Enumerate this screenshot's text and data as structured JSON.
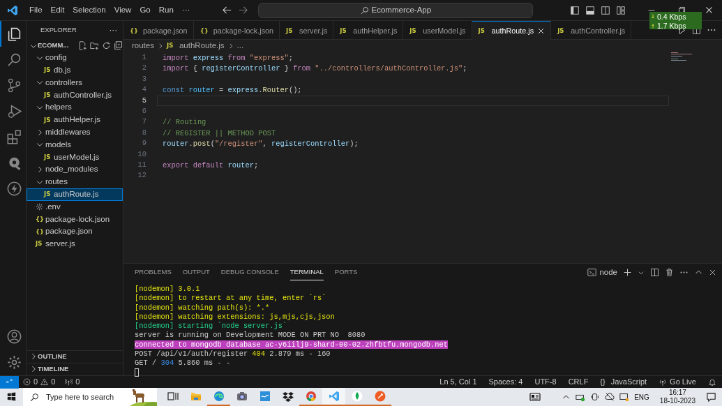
{
  "title_bar": {
    "menu": [
      "File",
      "Edit",
      "Selection",
      "View",
      "Go",
      "Run",
      "···"
    ],
    "search": "Ecommerce-App"
  },
  "network_widget": {
    "download": "0.4 Kbps",
    "upload": "1.7 Kbps"
  },
  "activity_bar": [
    {
      "kind": "explorer",
      "selected": true
    },
    {
      "kind": "search",
      "selected": false
    },
    {
      "kind": "source-control",
      "selected": false
    },
    {
      "kind": "debug",
      "selected": false
    },
    {
      "kind": "extensions",
      "selected": false
    },
    {
      "kind": "blob",
      "selected": false
    },
    {
      "kind": "bolt",
      "selected": false
    }
  ],
  "sidebar": {
    "title": "EXPLORER",
    "more": "···",
    "root": {
      "label": "ECOMM...",
      "expanded": true
    },
    "tree": [
      {
        "kind": "folder",
        "label": "config",
        "expanded": true,
        "selected": false,
        "children": [
          {
            "kind": "file",
            "badge": "JS",
            "label": "db.js",
            "selected": false
          }
        ]
      },
      {
        "kind": "folder",
        "label": "controllers",
        "expanded": true,
        "selected": false,
        "children": [
          {
            "kind": "file",
            "badge": "JS",
            "label": "authController.js",
            "selected": false
          }
        ]
      },
      {
        "kind": "folder",
        "label": "helpers",
        "expanded": true,
        "selected": false,
        "children": [
          {
            "kind": "file",
            "badge": "JS",
            "label": "authHelper.js",
            "selected": false
          }
        ]
      },
      {
        "kind": "folder",
        "label": "middlewares",
        "expanded": false,
        "selected": false
      },
      {
        "kind": "folder",
        "label": "models",
        "expanded": true,
        "selected": false,
        "children": [
          {
            "kind": "file",
            "badge": "JS",
            "label": "userModel.js",
            "selected": false
          }
        ]
      },
      {
        "kind": "folder",
        "label": "node_modules",
        "expanded": false,
        "selected": false
      },
      {
        "kind": "folder",
        "label": "routes",
        "expanded": true,
        "selected": false,
        "children": [
          {
            "kind": "file",
            "badge": "JS",
            "label": "authRoute.js",
            "selected": true
          }
        ]
      },
      {
        "kind": "env",
        "label": ".env",
        "selected": false
      },
      {
        "kind": "file",
        "badge": "{}",
        "label": "package-lock.json",
        "selected": false
      },
      {
        "kind": "file",
        "badge": "{}",
        "label": "package.json",
        "selected": false
      },
      {
        "kind": "file",
        "badge": "JS",
        "label": "server.js",
        "selected": false
      }
    ],
    "sections": [
      {
        "label": "OUTLINE",
        "expanded": false
      },
      {
        "label": "TIMELINE",
        "expanded": false
      }
    ]
  },
  "tabs": [
    {
      "badge": "{}",
      "label": "package.json",
      "selected": false
    },
    {
      "badge": "{}",
      "label": "package-lock.json",
      "selected": false
    },
    {
      "badge": "JS",
      "label": "server.js",
      "selected": false
    },
    {
      "badge": "JS",
      "label": "authHelper.js",
      "selected": false
    },
    {
      "badge": "JS",
      "label": "userModel.js",
      "selected": false
    },
    {
      "badge": "JS",
      "label": "authRoute.js",
      "selected": true
    },
    {
      "badge": "JS",
      "label": "authController.js",
      "selected": false
    }
  ],
  "breadcrumb": {
    "folder": "routes",
    "badge": "JS",
    "file": "authRoute.js",
    "rest": "..."
  },
  "editor": {
    "lines": [
      {
        "number": "1",
        "current": false,
        "tokens": [
          {
            "kind": "keyword",
            "text": "import "
          },
          {
            "kind": "variable",
            "text": "express "
          },
          {
            "kind": "keyword",
            "text": "from "
          },
          {
            "kind": "string",
            "text": "\"express\""
          },
          {
            "kind": "plain",
            "text": ";"
          }
        ]
      },
      {
        "number": "2",
        "current": false,
        "tokens": [
          {
            "kind": "keyword",
            "text": "import"
          },
          {
            "kind": "plain",
            "text": " { "
          },
          {
            "kind": "variable",
            "text": "registerController"
          },
          {
            "kind": "plain",
            "text": " } "
          },
          {
            "kind": "keyword",
            "text": "from "
          },
          {
            "kind": "string",
            "text": "\"../controllers/authController.js\""
          },
          {
            "kind": "plain",
            "text": ";"
          }
        ]
      },
      {
        "number": "3",
        "current": false
      },
      {
        "number": "4",
        "current": false,
        "tokens": [
          {
            "kind": "storage",
            "text": "const "
          },
          {
            "kind": "constant",
            "text": "router"
          },
          {
            "kind": "plain",
            "text": " = "
          },
          {
            "kind": "variable",
            "text": "express"
          },
          {
            "kind": "plain",
            "text": "."
          },
          {
            "kind": "function",
            "text": "Router"
          },
          {
            "kind": "plain",
            "text": "();"
          }
        ]
      },
      {
        "number": "5",
        "current": true
      },
      {
        "number": "6",
        "current": false
      },
      {
        "number": "7",
        "current": false,
        "tokens": [
          {
            "kind": "comment",
            "text": "// Routing"
          }
        ]
      },
      {
        "number": "8",
        "current": false,
        "tokens": [
          {
            "kind": "comment",
            "text": "// REGISTER || METHOD POST"
          }
        ]
      },
      {
        "number": "9",
        "current": false,
        "tokens": [
          {
            "kind": "variable",
            "text": "router"
          },
          {
            "kind": "plain",
            "text": "."
          },
          {
            "kind": "function",
            "text": "post"
          },
          {
            "kind": "plain",
            "text": "("
          },
          {
            "kind": "string",
            "text": "\"/register\""
          },
          {
            "kind": "plain",
            "text": ", "
          },
          {
            "kind": "variable",
            "text": "registerController"
          },
          {
            "kind": "plain",
            "text": ");"
          }
        ]
      },
      {
        "number": "10",
        "current": false
      },
      {
        "number": "11",
        "current": false,
        "tokens": [
          {
            "kind": "keyword",
            "text": "export default "
          },
          {
            "kind": "variable",
            "text": "router"
          },
          {
            "kind": "plain",
            "text": ";"
          }
        ]
      },
      {
        "number": "12",
        "current": false
      }
    ]
  },
  "panel": {
    "tabs": [
      {
        "label": "PROBLEMS",
        "selected": false
      },
      {
        "label": "OUTPUT",
        "selected": false
      },
      {
        "label": "DEBUG CONSOLE",
        "selected": false
      },
      {
        "label": "TERMINAL",
        "selected": true
      },
      {
        "label": "PORTS",
        "selected": false
      }
    ],
    "terminal_name": "node",
    "lines": [
      [
        {
          "kind": "yellow",
          "text": "[nodemon] 3.0.1"
        }
      ],
      [
        {
          "kind": "yellow",
          "text": "[nodemon] to restart at any time, enter `rs`"
        }
      ],
      [
        {
          "kind": "yellow",
          "text": "[nodemon] watching path(s): *.*"
        }
      ],
      [
        {
          "kind": "yellow",
          "text": "[nodemon] watching extensions: js,mjs,cjs,json"
        }
      ],
      [
        {
          "kind": "green",
          "text": "[nodemon] starting `node server.js`"
        }
      ],
      [
        {
          "kind": "plain",
          "text": "server is running on Development MODE ON PRT NO  8080"
        }
      ],
      [
        {
          "kind": "highlight",
          "text": "connected to mongodb database ac-y6iilj9-shard-00-02.zhfbtfu.mongodb.net"
        }
      ],
      [
        {
          "kind": "plain",
          "text": "POST /api/v1/auth/register "
        },
        {
          "kind": "yellow",
          "text": "404"
        },
        {
          "kind": "plain",
          "text": " 2.879 ms - 160"
        }
      ],
      [
        {
          "kind": "plain",
          "text": "GET / "
        },
        {
          "kind": "blue",
          "text": "304"
        },
        {
          "kind": "plain",
          "text": " 5.860 ms - -"
        }
      ]
    ]
  },
  "status_bar": {
    "errors": "0",
    "warnings": "0",
    "ports": "0",
    "position": "Ln 5, Col 1",
    "indent": "Spaces: 4",
    "encoding": "UTF-8",
    "eol": "CRLF",
    "language_icon": "{}",
    "language": "JavaScript",
    "live": "Go Live"
  },
  "taskbar": {
    "search_placeholder": "Type here to search",
    "apps": [
      {
        "kind": "task-view",
        "running": false,
        "selected": false
      },
      {
        "kind": "folder",
        "running": false,
        "selected": false
      },
      {
        "kind": "browser",
        "running": true,
        "selected": false
      },
      {
        "kind": "camera",
        "running": false,
        "selected": false
      },
      {
        "kind": "app",
        "running": false,
        "selected": false
      },
      {
        "kind": "boxes",
        "running": false,
        "selected": false
      },
      {
        "kind": "chrome",
        "running": true,
        "selected": false
      },
      {
        "kind": "vscode",
        "running": true,
        "selected": true
      },
      {
        "kind": "leaf",
        "running": true,
        "selected": false
      },
      {
        "kind": "rocket",
        "running": true,
        "selected": false
      }
    ],
    "language": "ENG",
    "time": "16:17",
    "date": "18-10-2023"
  }
}
